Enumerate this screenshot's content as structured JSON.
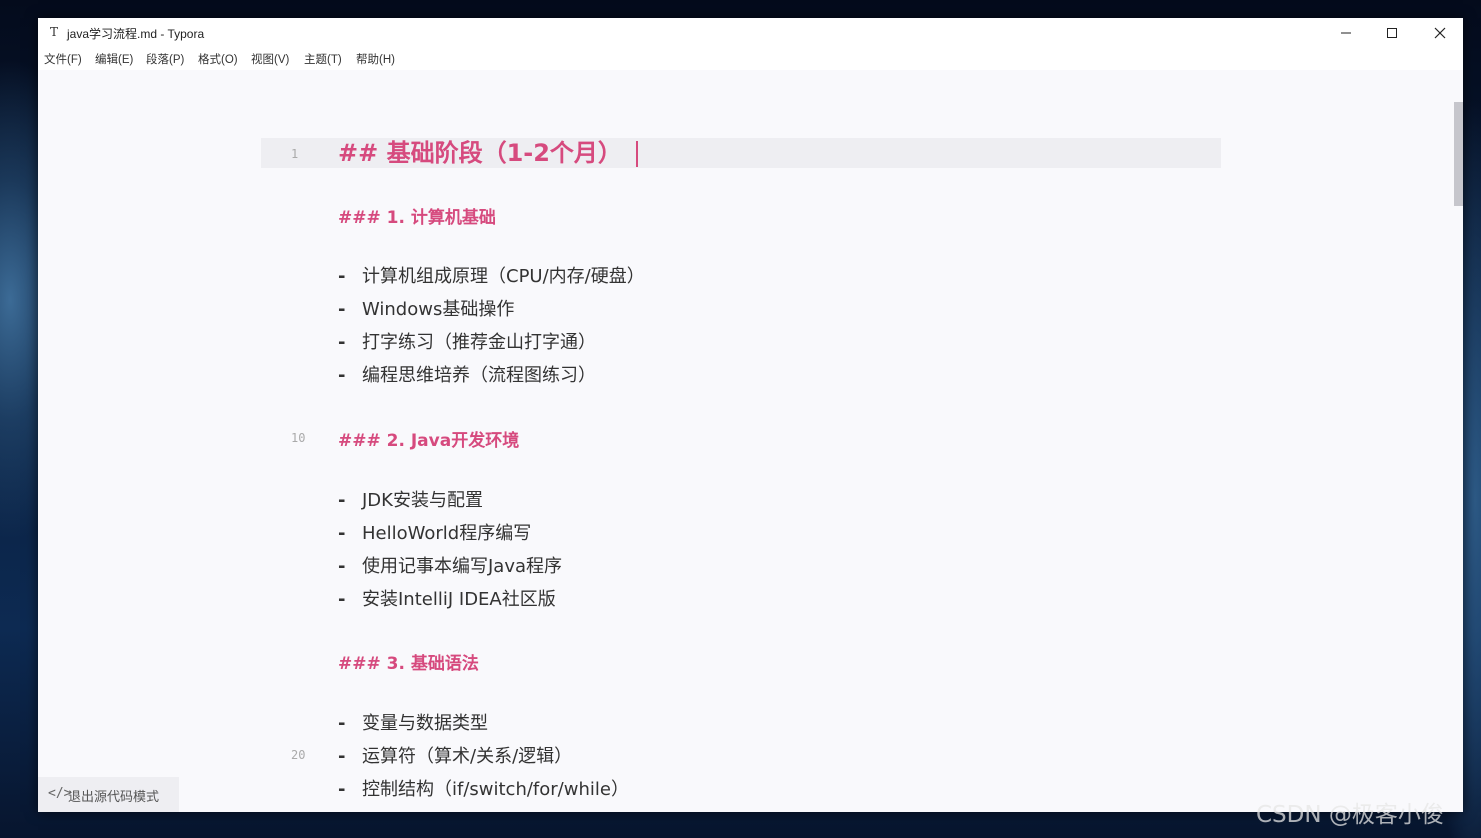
{
  "window": {
    "title": "java学习流程.md - Typora",
    "app_icon": "T"
  },
  "menu": [
    "文件(F)",
    "编辑(E)",
    "段落(P)",
    "格式(O)",
    "视图(V)",
    "主题(T)",
    "帮助(H)"
  ],
  "editor": {
    "line_numbers": [
      "1",
      "10",
      "20"
    ],
    "heading": "## 基础阶段（1-2个月）",
    "sections": [
      {
        "heading": "### 1. 计算机基础",
        "items": [
          "计算机组成原理（CPU/内存/硬盘）",
          "Windows基础操作",
          "打字练习（推荐金山打字通）",
          "编程思维培养（流程图练习）"
        ]
      },
      {
        "heading": "### 2. Java开发环境",
        "items": [
          "JDK安装与配置",
          "HelloWorld程序编写",
          "使用记事本编写Java程序",
          "安装IntelliJ IDEA社区版"
        ]
      },
      {
        "heading": "### 3. 基础语法",
        "items": [
          "变量与数据类型",
          "运算符（算术/关系/逻辑）",
          "控制结构（if/switch/for/while）"
        ]
      }
    ],
    "list_marker": "-"
  },
  "status": {
    "exit_source_label": "退出源代码模式",
    "exit_source_icon": "code-icon"
  },
  "watermark": "CSDN @极客小俊",
  "colors": {
    "accent": "#d64a7e",
    "text": "#333333",
    "background": "#f9f9fc"
  }
}
